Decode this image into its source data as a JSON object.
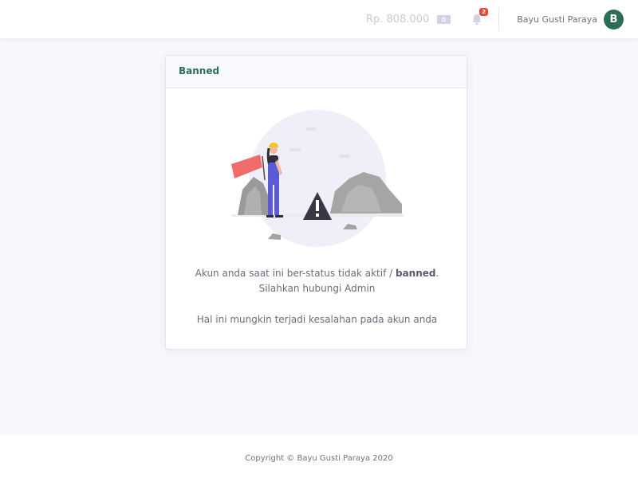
{
  "topbar": {
    "balance": "Rp. 808.000",
    "balance_icon": "money-icon",
    "notification_count": "2",
    "user_name": "Bayu Gusti Paraya",
    "avatar_initial": "B"
  },
  "card": {
    "title": "Banned",
    "message_line1_prefix": "Akun anda saat ini ber-status tidak aktif / ",
    "message_line1_bold": "banned",
    "message_line1_suffix": ".",
    "message_line2": "Silahkan hubungi Admin",
    "message_line3": "Hal ini mungkin terjadi kesalahan pada akun anda"
  },
  "footer": {
    "copyright": "Copyright © Bayu Gusti Paraya 2020"
  },
  "colors": {
    "accent": "#2e6d55",
    "badge": "#e74a3b",
    "figure_overalls": "#5b5bd6",
    "flag": "#f26b6b"
  }
}
